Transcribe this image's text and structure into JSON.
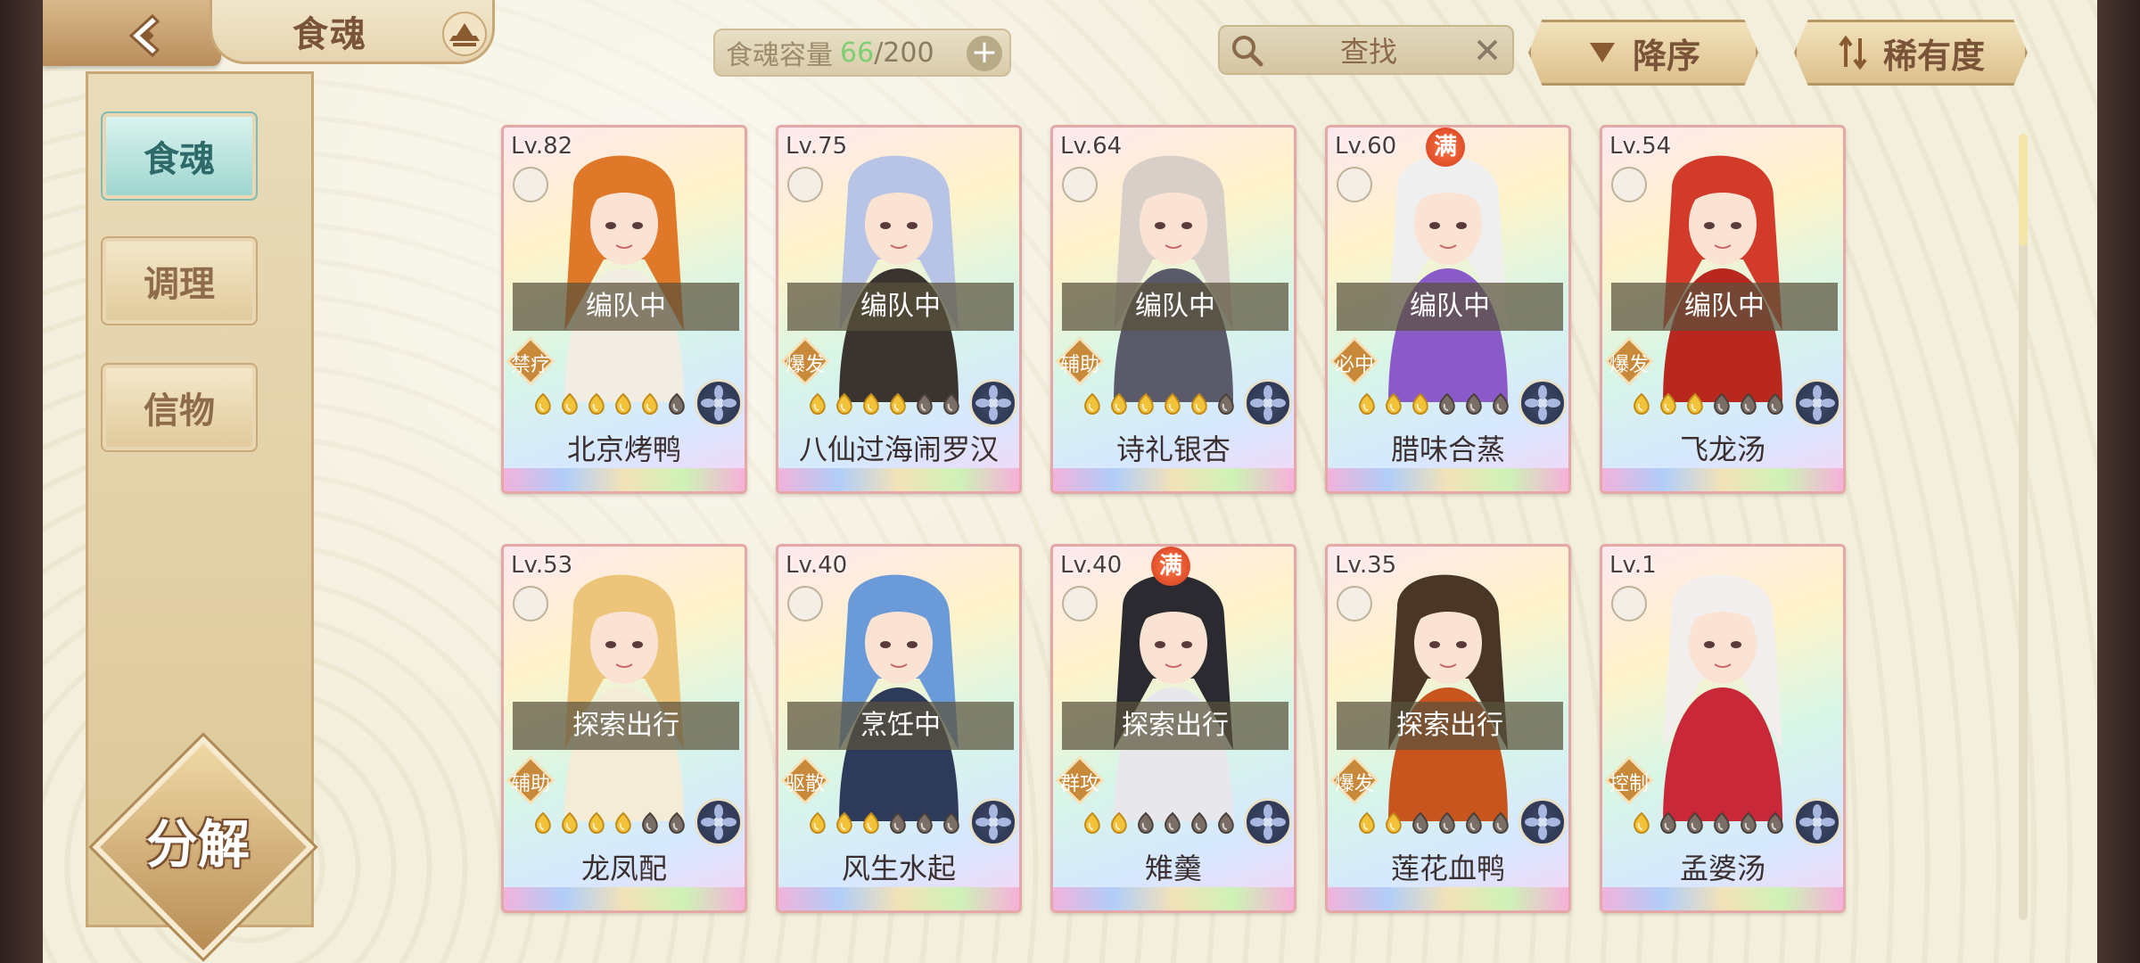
{
  "header": {
    "title": "食魂",
    "capacity_label": "食魂容量",
    "capacity_current": "66",
    "capacity_max": "/200",
    "search_placeholder": "查找",
    "sort_order_label": "降序",
    "sort_field_label": "稀有度"
  },
  "sidebar": {
    "items": [
      {
        "label": "食魂",
        "active": true
      },
      {
        "label": "调理",
        "active": false
      },
      {
        "label": "信物",
        "active": false
      }
    ],
    "decompose_label": "分解"
  },
  "cards": [
    {
      "level": "Lv.82",
      "status": "编队中",
      "role": "禁疗",
      "stars": 5,
      "name": "北京烤鸭",
      "full": false,
      "hair": "#e0782a",
      "outfit": "#f2ede2"
    },
    {
      "level": "Lv.75",
      "status": "编队中",
      "role": "爆发",
      "stars": 4,
      "name": "八仙过海闹罗汉",
      "full": false,
      "hair": "#b8c4e6",
      "outfit": "#3a3430"
    },
    {
      "level": "Lv.64",
      "status": "编队中",
      "role": "辅助",
      "stars": 5,
      "name": "诗礼银杏",
      "full": false,
      "hair": "#d8d0c8",
      "outfit": "#5a5a6a"
    },
    {
      "level": "Lv.60",
      "status": "编队中",
      "role": "必中",
      "stars": 3,
      "name": "腊味合蒸",
      "full": true,
      "full_label": "满",
      "hair": "#efefef",
      "outfit": "#8a5ac8"
    },
    {
      "level": "Lv.54",
      "status": "编队中",
      "role": "爆发",
      "stars": 3,
      "name": "飞龙汤",
      "full": false,
      "hair": "#d23a2a",
      "outfit": "#b8281e"
    },
    {
      "level": "Lv.53",
      "status": "探索出行",
      "role": "辅助",
      "stars": 4,
      "name": "龙凤配",
      "full": false,
      "hair": "#ecc47a",
      "outfit": "#f4ecd6"
    },
    {
      "level": "Lv.40",
      "status": "烹饪中",
      "role": "驱散",
      "stars": 3,
      "name": "风生水起",
      "full": false,
      "hair": "#6a9ad8",
      "outfit": "#2e3a5a"
    },
    {
      "level": "Lv.40",
      "status": "探索出行",
      "role": "群攻",
      "stars": 2,
      "name": "雉羹",
      "full": true,
      "full_label": "满",
      "hair": "#2a2a30",
      "outfit": "#e8e8ec"
    },
    {
      "level": "Lv.35",
      "status": "探索出行",
      "role": "爆发",
      "stars": 2,
      "name": "莲花血鸭",
      "full": false,
      "hair": "#4a3626",
      "outfit": "#c8541e"
    },
    {
      "level": "Lv.1",
      "status": "",
      "role": "控制",
      "stars": 1,
      "name": "孟婆汤",
      "full": false,
      "hair": "#f2eeee",
      "outfit": "#c82838"
    }
  ],
  "colors": {
    "accent_teal": "#9fd6cf",
    "capacity_green": "#7ccf73",
    "gold": "#dcc08c",
    "role_badge": "#c88a3a"
  }
}
